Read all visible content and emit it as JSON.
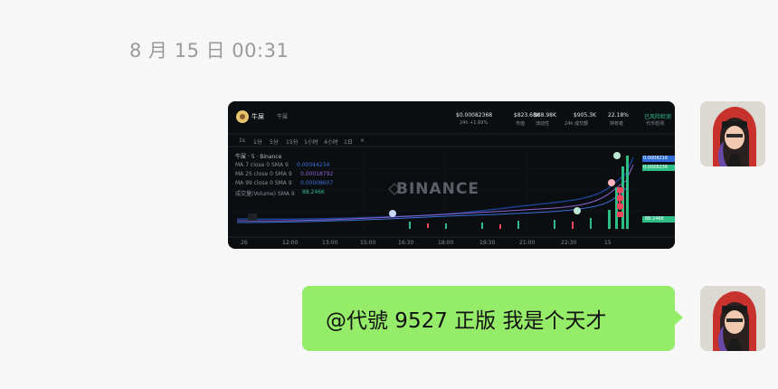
{
  "timestamp": "8 月 15 日 00:31",
  "messages": [
    {
      "type": "image",
      "chart_screenshot": {
        "token_name": "牛屎",
        "chain_label": "牛屎",
        "stats": [
          {
            "value": "$0.00082368",
            "label": "24h +1.69%"
          },
          {
            "value": "$823.68K",
            "label": "市值"
          },
          {
            "value": "$88.98K",
            "label": "流动性"
          },
          {
            "value": "$905.3K",
            "label": "24h 成交额"
          },
          {
            "value": "22.18%",
            "label": "持有者"
          },
          {
            "value": "已风险检测",
            "label": "代币检测"
          }
        ],
        "timeframes": [
          "1s",
          "1分",
          "5分",
          "15分",
          "1小时",
          "4小时",
          "1日",
          "×"
        ],
        "series_caption": "牛屎 · 5 · Binance",
        "indicators": [
          {
            "label": "MA 7 close 0 SMA 9",
            "value": "0.00044234"
          },
          {
            "label": "MA 25 close 0 SMA 9",
            "value": "0.00018792"
          },
          {
            "label": "MA 99 close 0 SMA 9",
            "value": "0.00008607"
          },
          {
            "label": "成交量(Volume) SMA 9",
            "value": "88.246K"
          }
        ],
        "watermark": "BINANCE",
        "x_ticks": [
          "26",
          "12:00",
          "13:00",
          "15:00",
          "16:30",
          "18:00",
          "19:30",
          "21:00",
          "22:30",
          "15"
        ],
        "price_tags": [
          "0.0008216",
          "0.0008236",
          "88.246K"
        ],
        "colors": {
          "up": "#2ebd85",
          "down": "#f6465d",
          "ma1": "#3b6fd8",
          "ma2": "#8a63d2",
          "ma3": "#1c3f8f"
        }
      }
    },
    {
      "type": "text",
      "text": "@代號 9527 正版 我是个天才"
    }
  ]
}
